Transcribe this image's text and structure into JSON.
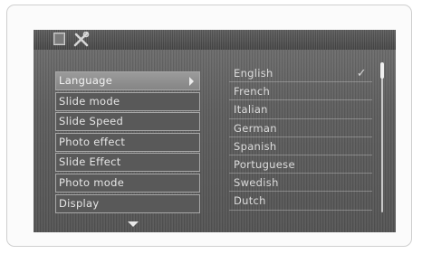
{
  "menu": {
    "items": [
      {
        "label": "Language"
      },
      {
        "label": "Slide mode"
      },
      {
        "label": "Slide Speed"
      },
      {
        "label": "Photo effect"
      },
      {
        "label": "Slide Effect"
      },
      {
        "label": "Photo mode"
      },
      {
        "label": "Display"
      }
    ],
    "selected": "Language"
  },
  "languages": {
    "items": [
      {
        "label": "English"
      },
      {
        "label": "French"
      },
      {
        "label": "Italian"
      },
      {
        "label": "German"
      },
      {
        "label": "Spanish"
      },
      {
        "label": "Portuguese"
      },
      {
        "label": "Swedish"
      },
      {
        "label": "Dutch"
      }
    ],
    "checked": "English",
    "scroll_position": 0
  },
  "icons": {
    "top_left": "photo-icon",
    "top_second": "settings-tools-icon",
    "more_below": "chevron-down-icon",
    "checked": "checkmark-icon",
    "submenu": "chevron-right-icon"
  },
  "colors": {
    "screen_bg": "#5c5c5c",
    "selected_item": "#8f8f8f",
    "text": "#e6e6e6",
    "border": "#a8a8a8"
  }
}
